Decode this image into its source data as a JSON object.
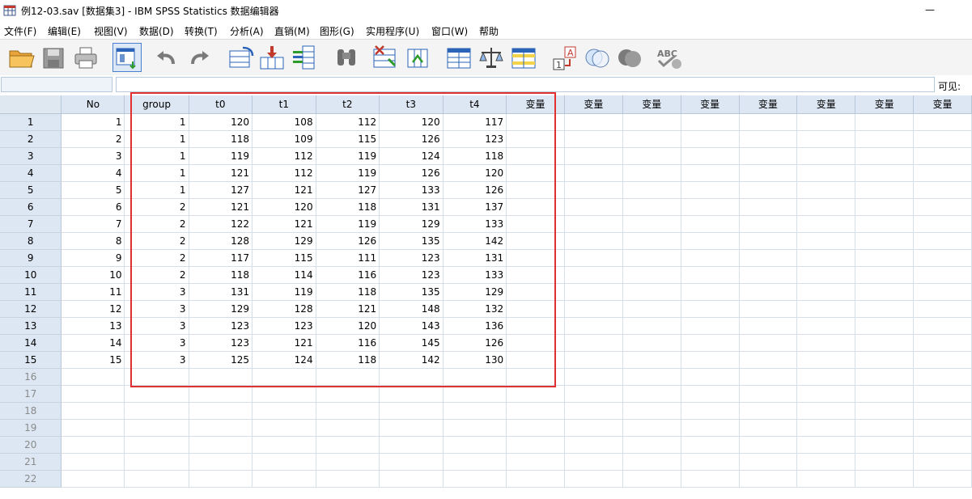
{
  "window": {
    "title": "例12-03.sav [数据集3] - IBM SPSS Statistics 数据编辑器",
    "minimize_glyph": "—"
  },
  "menu": [
    "文件(F)",
    "编辑(E)",
    "视图(V)",
    "数据(D)",
    "转换(T)",
    "分析(A)",
    "直销(M)",
    "图形(G)",
    "实用程序(U)",
    "窗口(W)",
    "帮助"
  ],
  "toolbar": {
    "buttons": [
      {
        "name": "open-data-icon"
      },
      {
        "name": "save-icon"
      },
      {
        "name": "print-icon"
      },
      {
        "name": "dialog-recall-icon"
      },
      {
        "name": "undo-icon"
      },
      {
        "name": "redo-icon"
      },
      {
        "name": "goto-case-icon"
      },
      {
        "name": "goto-variable-icon"
      },
      {
        "name": "variables-icon"
      },
      {
        "name": "find-icon"
      },
      {
        "name": "insert-cases-icon"
      },
      {
        "name": "insert-variable-icon"
      },
      {
        "name": "split-file-icon"
      },
      {
        "name": "weight-cases-icon"
      },
      {
        "name": "select-cases-icon"
      },
      {
        "name": "value-labels-icon"
      },
      {
        "name": "use-variable-sets-icon"
      },
      {
        "name": "show-all-variables-icon"
      },
      {
        "name": "spell-check-icon"
      }
    ]
  },
  "editor": {
    "cell_ref": "",
    "cell_value": "",
    "visible_label": "可见: "
  },
  "grid": {
    "columns": [
      "No",
      "group",
      "t0",
      "t1",
      "t2",
      "t3",
      "t4",
      "变量",
      "变量",
      "变量",
      "变量",
      "变量",
      "变量",
      "变量",
      "变量"
    ],
    "rows": [
      {
        "n": "1",
        "cells": [
          "1",
          "1",
          "120",
          "108",
          "112",
          "120",
          "117"
        ]
      },
      {
        "n": "2",
        "cells": [
          "2",
          "1",
          "118",
          "109",
          "115",
          "126",
          "123"
        ]
      },
      {
        "n": "3",
        "cells": [
          "3",
          "1",
          "119",
          "112",
          "119",
          "124",
          "118"
        ]
      },
      {
        "n": "4",
        "cells": [
          "4",
          "1",
          "121",
          "112",
          "119",
          "126",
          "120"
        ]
      },
      {
        "n": "5",
        "cells": [
          "5",
          "1",
          "127",
          "121",
          "127",
          "133",
          "126"
        ]
      },
      {
        "n": "6",
        "cells": [
          "6",
          "2",
          "121",
          "120",
          "118",
          "131",
          "137"
        ]
      },
      {
        "n": "7",
        "cells": [
          "7",
          "2",
          "122",
          "121",
          "119",
          "129",
          "133"
        ]
      },
      {
        "n": "8",
        "cells": [
          "8",
          "2",
          "128",
          "129",
          "126",
          "135",
          "142"
        ]
      },
      {
        "n": "9",
        "cells": [
          "9",
          "2",
          "117",
          "115",
          "111",
          "123",
          "131"
        ]
      },
      {
        "n": "10",
        "cells": [
          "10",
          "2",
          "118",
          "114",
          "116",
          "123",
          "133"
        ]
      },
      {
        "n": "11",
        "cells": [
          "11",
          "3",
          "131",
          "119",
          "118",
          "135",
          "129"
        ]
      },
      {
        "n": "12",
        "cells": [
          "12",
          "3",
          "129",
          "128",
          "121",
          "148",
          "132"
        ]
      },
      {
        "n": "13",
        "cells": [
          "13",
          "3",
          "123",
          "123",
          "120",
          "143",
          "136"
        ]
      },
      {
        "n": "14",
        "cells": [
          "14",
          "3",
          "123",
          "121",
          "116",
          "145",
          "126"
        ]
      },
      {
        "n": "15",
        "cells": [
          "15",
          "3",
          "125",
          "124",
          "118",
          "142",
          "130"
        ]
      },
      {
        "n": "16",
        "cells": []
      },
      {
        "n": "17",
        "cells": []
      },
      {
        "n": "18",
        "cells": []
      },
      {
        "n": "19",
        "cells": []
      },
      {
        "n": "20",
        "cells": []
      },
      {
        "n": "21",
        "cells": []
      },
      {
        "n": "22",
        "cells": []
      }
    ]
  },
  "colors": {
    "header_bg": "#dde7f3",
    "grid_line": "#d6dee8",
    "highlight": "#e03030"
  }
}
